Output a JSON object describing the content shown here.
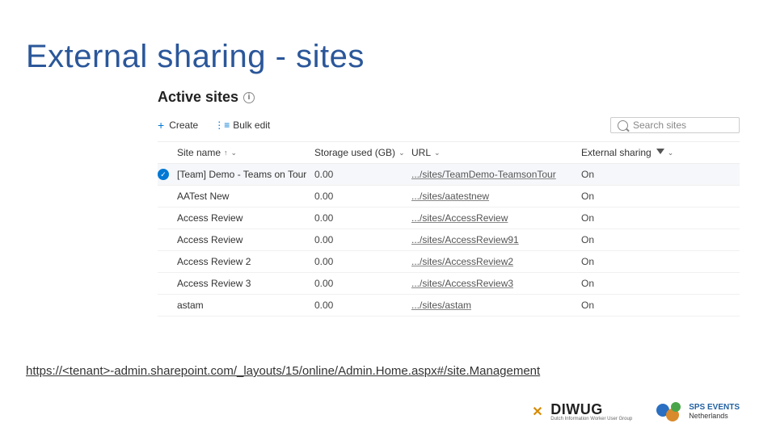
{
  "slide_title": "External sharing - sites",
  "panel_title": "Active sites",
  "toolbar": {
    "create_label": "Create",
    "bulk_edit_label": "Bulk edit"
  },
  "search": {
    "placeholder": "Search sites"
  },
  "columns": {
    "site_name": "Site name",
    "storage": "Storage used (GB)",
    "url": "URL",
    "external_sharing": "External sharing"
  },
  "rows": [
    {
      "selected": true,
      "name": "[Team] Demo - Teams on Tour",
      "storage": "0.00",
      "url": ".../sites/TeamDemo-TeamsonTour",
      "sharing": "On"
    },
    {
      "selected": false,
      "name": "AATest New",
      "storage": "0.00",
      "url": ".../sites/aatestnew",
      "sharing": "On"
    },
    {
      "selected": false,
      "name": "Access Review",
      "storage": "0.00",
      "url": ".../sites/AccessReview",
      "sharing": "On"
    },
    {
      "selected": false,
      "name": "Access Review",
      "storage": "0.00",
      "url": ".../sites/AccessReview91",
      "sharing": "On"
    },
    {
      "selected": false,
      "name": "Access Review 2",
      "storage": "0.00",
      "url": ".../sites/AccessReview2",
      "sharing": "On"
    },
    {
      "selected": false,
      "name": "Access Review 3",
      "storage": "0.00",
      "url": ".../sites/AccessReview3",
      "sharing": "On"
    },
    {
      "selected": false,
      "name": "astam",
      "storage": "0.00",
      "url": ".../sites/astam",
      "sharing": "On"
    }
  ],
  "footer_url": "https://<tenant>-admin.sharepoint.com/_layouts/15/online/Admin.Home.aspx#/site.Management",
  "logos": {
    "diwug": "DIWUG",
    "diwug_sub": "Dutch Information Worker User Group",
    "sps": "SPS EVENTS",
    "sps_sub": "Netherlands"
  }
}
